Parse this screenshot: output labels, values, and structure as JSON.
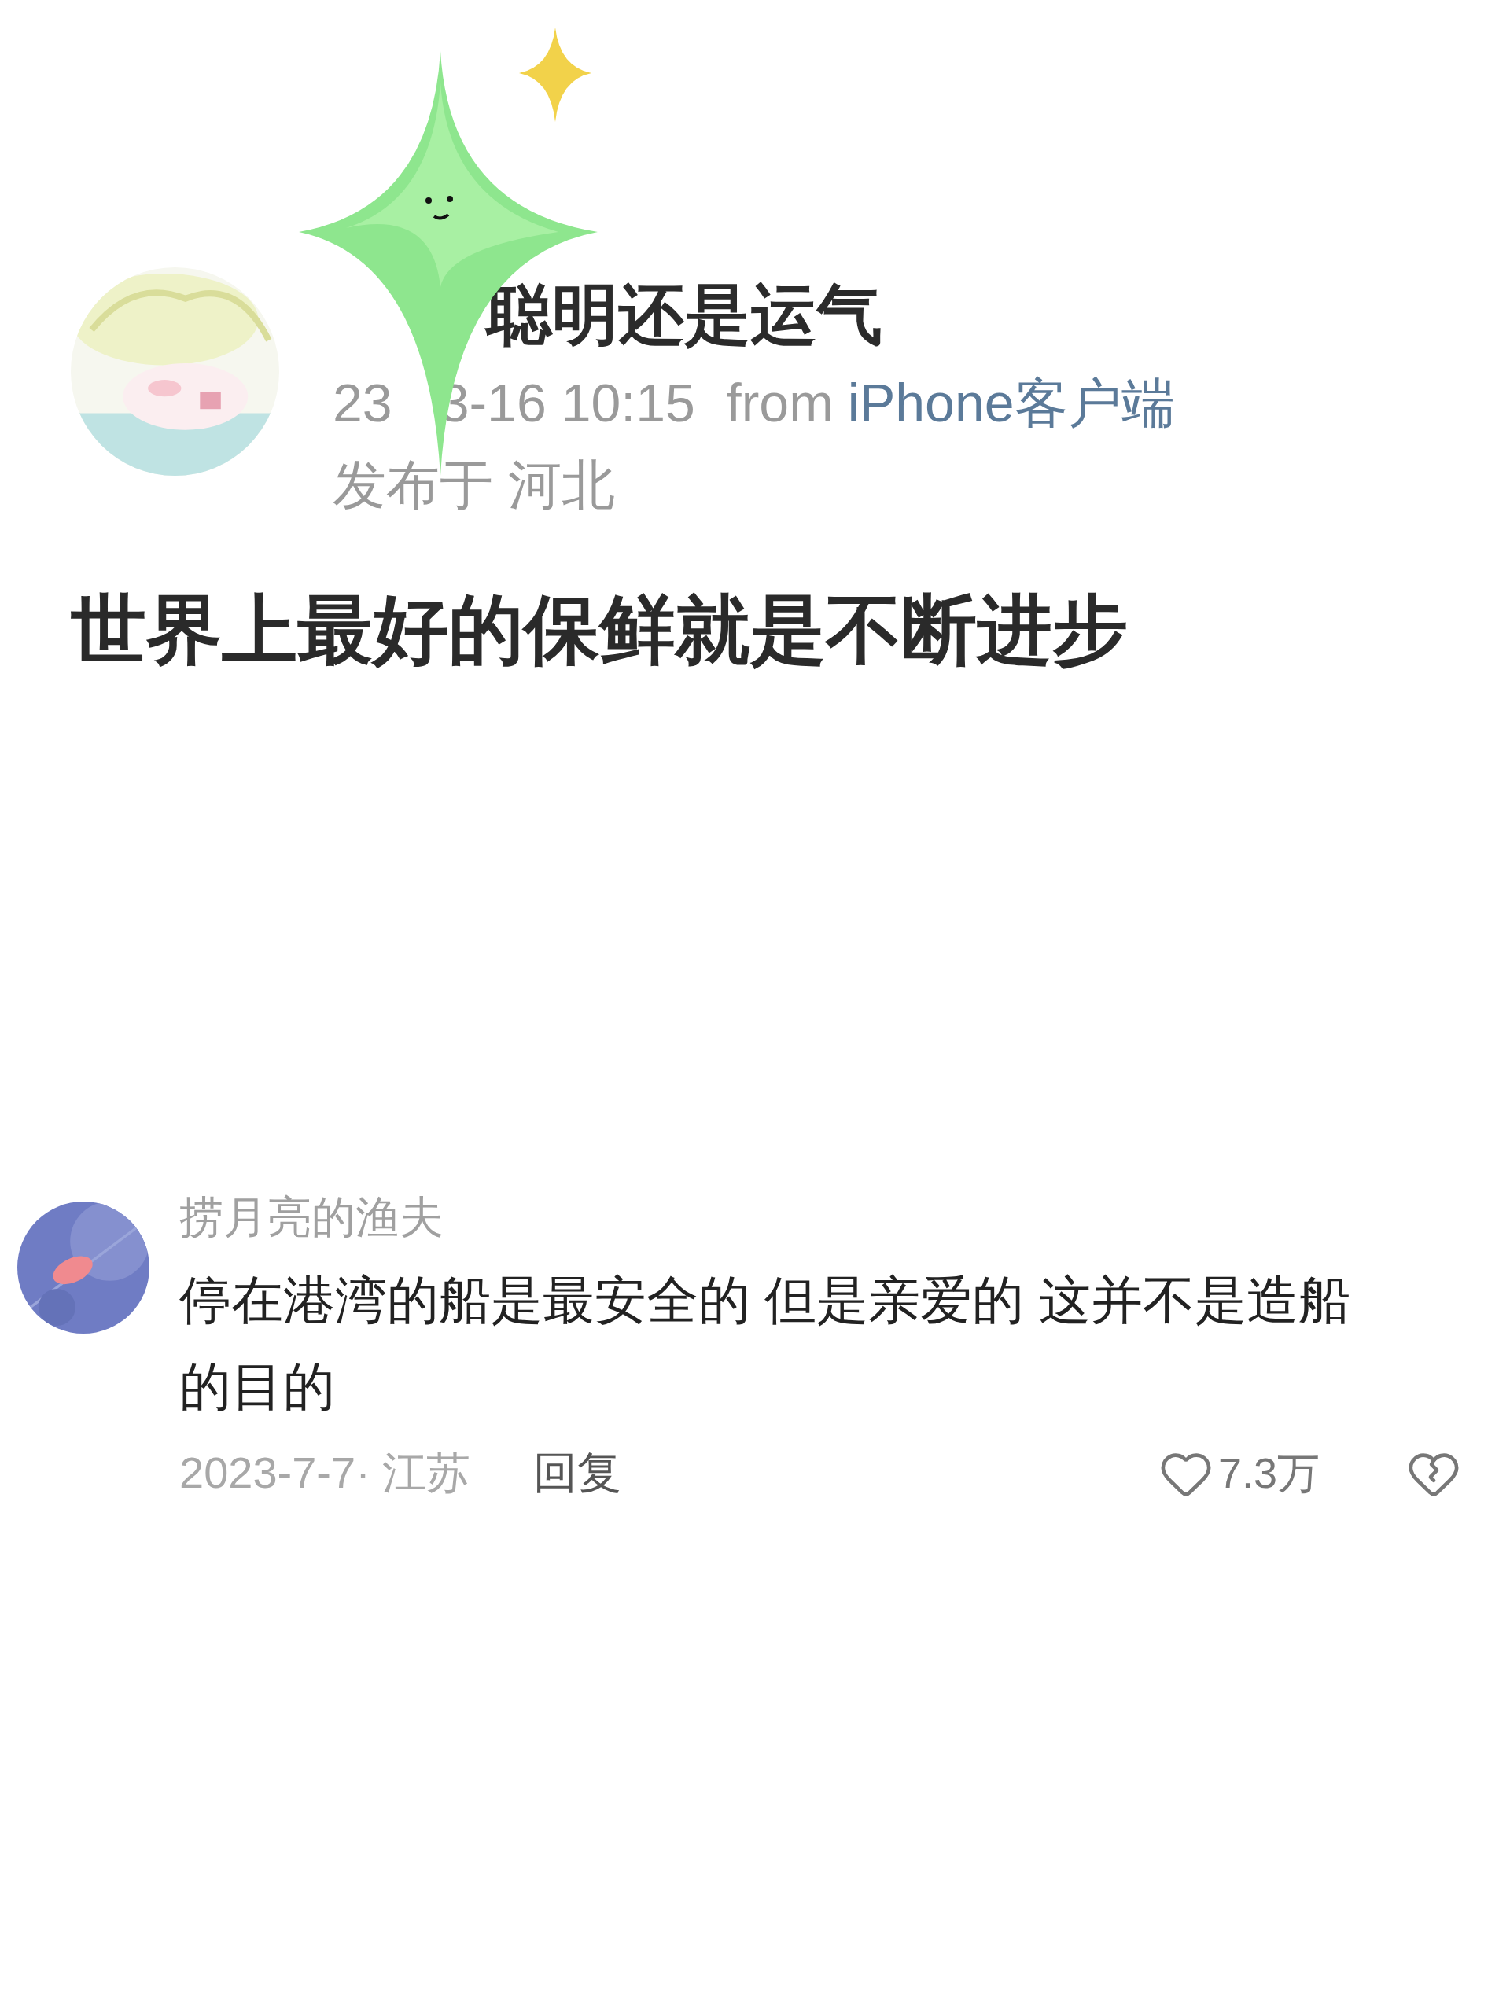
{
  "post": {
    "title": "聪明还是运气",
    "date_start": "23",
    "date_rest": "3-16 10:15",
    "source_prefix": "from",
    "source": "iPhone客户端",
    "location": "发布于 河北",
    "body": "世界上最好的保鲜就是不断进步"
  },
  "comment": {
    "author": "捞月亮的渔夫",
    "text": "停在港湾的船是最安全的 但是亲爱的 这并不是造船的目的",
    "date_location": "2023-7-7· 江苏",
    "reply": "回复",
    "likes": "7.3万"
  }
}
